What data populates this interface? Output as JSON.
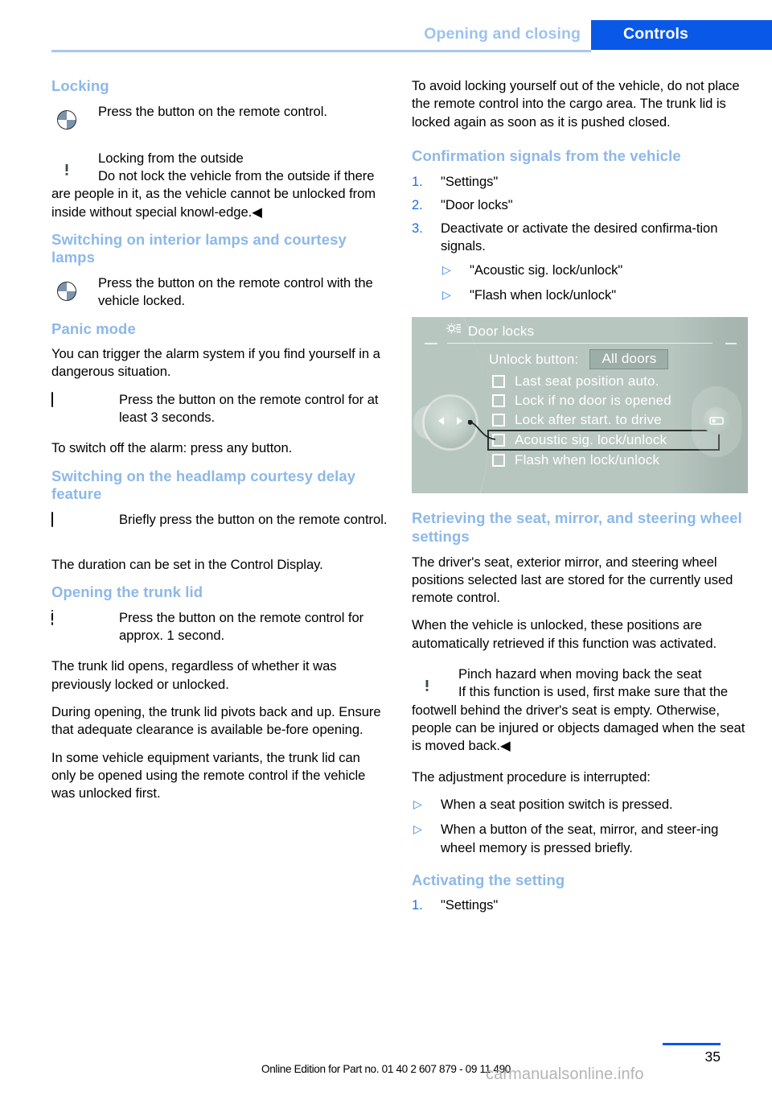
{
  "header": {
    "chapter": "Opening and closing",
    "section": "Controls"
  },
  "left_column": {
    "locking": {
      "heading": "Locking",
      "bmw_instruction": "Press the button on the remote control.",
      "warning_title": "Locking from the outside",
      "warning_body": "Do not lock the vehicle from the outside if there are people in it, as the vehicle cannot be unlocked from inside without special knowl-edge.◀"
    },
    "interior_lamps": {
      "heading": "Switching on interior lamps and courtesy lamps",
      "bmw_instruction": "Press the button on the remote control with the vehicle locked."
    },
    "panic_mode": {
      "heading": "Panic mode",
      "intro": "You can trigger the alarm system if you find yourself in a dangerous situation.",
      "key_instruction": "Press the button on the remote control for at least 3 seconds.",
      "switch_off": "To switch off the alarm: press any button."
    },
    "headlamp_courtesy": {
      "heading": "Switching on the headlamp courtesy delay feature",
      "key_instruction": "Briefly press the button on the remote control.",
      "duration_note": "The duration can be set in the Control Display."
    },
    "trunk_lid": {
      "heading": "Opening the trunk lid",
      "key_instruction": "Press the button on the remote control for approx. 1 second.",
      "para1": "The trunk lid opens, regardless of whether it was previously locked or unlocked.",
      "para2": "During opening, the trunk lid pivots back and up. Ensure that adequate clearance is available be-fore opening.",
      "para3": "In some vehicle equipment variants, the trunk lid can only be opened using the remote control if the vehicle was unlocked first."
    }
  },
  "right_column": {
    "cargo_warning": "To avoid locking yourself out of the vehicle, do not place the remote control into the cargo area. The trunk lid is locked again as soon as it is pushed closed.",
    "confirmation_signals": {
      "heading": "Confirmation signals from the vehicle",
      "steps": [
        {
          "num": "1.",
          "text": "\"Settings\""
        },
        {
          "num": "2.",
          "text": "\"Door locks\""
        },
        {
          "num": "3.",
          "text": "Deactivate or activate the desired confirma-tion signals."
        }
      ],
      "substeps": [
        "\"Acoustic sig. lock/unlock\"",
        "\"Flash when lock/unlock\""
      ]
    },
    "idrive_screen": {
      "title": "Door locks",
      "title_icon": "settings-gear-icon",
      "unlock_label": "Unlock button:",
      "unlock_value": "All doors",
      "options": [
        {
          "label": "Last seat position auto.",
          "checked": false,
          "selected": false
        },
        {
          "label": "Lock if no door is opened",
          "checked": false,
          "selected": false
        },
        {
          "label": "Lock after start. to drive",
          "checked": false,
          "selected": false
        },
        {
          "label": "Acoustic sig. lock/unlock",
          "checked": false,
          "selected": true
        },
        {
          "label": "Flash when lock/unlock",
          "checked": false,
          "selected": false
        }
      ]
    },
    "retrieving_settings": {
      "heading": "Retrieving the seat, mirror, and steering wheel settings",
      "para1": "The driver's seat, exterior mirror, and steering wheel positions selected last are stored for the currently used remote control.",
      "para2": "When the vehicle is unlocked, these positions are automatically retrieved if this function was activated.",
      "warning_title": "Pinch hazard when moving back the seat",
      "warning_body": "If this function is used, first make sure that the footwell behind the driver's seat is empty. Otherwise, people can be injured or objects damaged when the seat is moved back.◀",
      "interrupt_intro": "The adjustment procedure is interrupted:",
      "interrupt_items": [
        "When a seat position switch is pressed.",
        "When a button of the seat, mirror, and steer-ing wheel memory is pressed briefly."
      ]
    },
    "activating": {
      "heading": "Activating the setting",
      "steps": [
        {
          "num": "1.",
          "text": "\"Settings\""
        }
      ]
    }
  },
  "footer": {
    "edition_text": "Online Edition for Part no. 01 40 2 607 879 - 09 11 490",
    "page_number": "35",
    "watermark": "carmanualsonline.info"
  },
  "colors": {
    "heading_blue": "#8cb8e8",
    "tab_blue": "#0a58e8",
    "rule_blue": "#a8c8ef",
    "list_number_blue": "#1b6ee8",
    "idrive_bg": "#b8c6c0"
  }
}
